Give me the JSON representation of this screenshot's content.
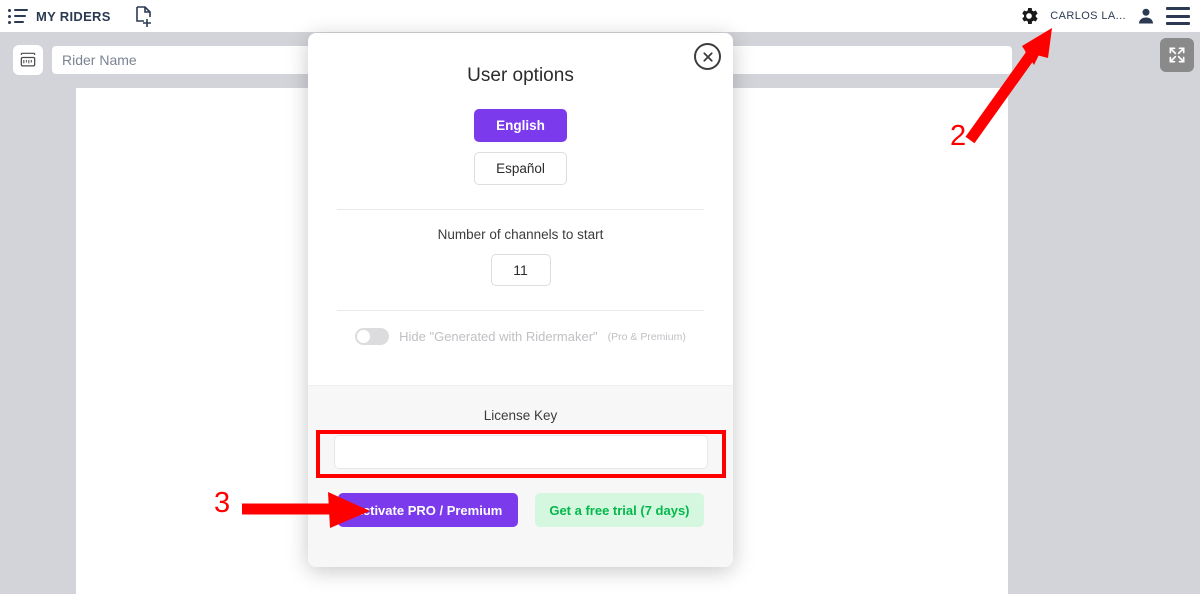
{
  "topbar": {
    "list_icon": "list-icon",
    "app_label": "MY RIDERS",
    "new_doc_icon": "new-document-icon",
    "gear_icon": "gear-icon",
    "username": "CARLOS LA...",
    "avatar_icon": "user-avatar-icon",
    "menu_icon": "hamburger-menu-icon"
  },
  "toolbar": {
    "ruler_icon": "ruler-icon",
    "search_placeholder": "Rider Name",
    "search_value": "",
    "expand_icon": "fullscreen-expand-icon"
  },
  "modal": {
    "title": "User options",
    "close_icon": "close-icon",
    "languages": [
      {
        "label": "English",
        "active": true
      },
      {
        "label": "Español",
        "active": false
      }
    ],
    "channels": {
      "label": "Number of channels to start",
      "value": "11"
    },
    "hide_watermark": {
      "label": "Hide \"Generated with Ridermaker\"",
      "note": "(Pro & Premium)",
      "enabled": false
    },
    "license": {
      "label": "License Key",
      "value": "",
      "placeholder": ""
    },
    "buttons": {
      "activate": "Activate PRO / Premium",
      "trial": "Get a free trial (7 days)"
    }
  },
  "annotations": {
    "step2": "2",
    "step3": "3",
    "highlight_color": "#ff0000"
  },
  "colors": {
    "accent_purple": "#7c3aed",
    "trial_green": "#04b84b",
    "trial_green_bg": "#d5f7e0",
    "canvas_grey": "#d2d4d9",
    "annotation_red": "#ff0000"
  }
}
